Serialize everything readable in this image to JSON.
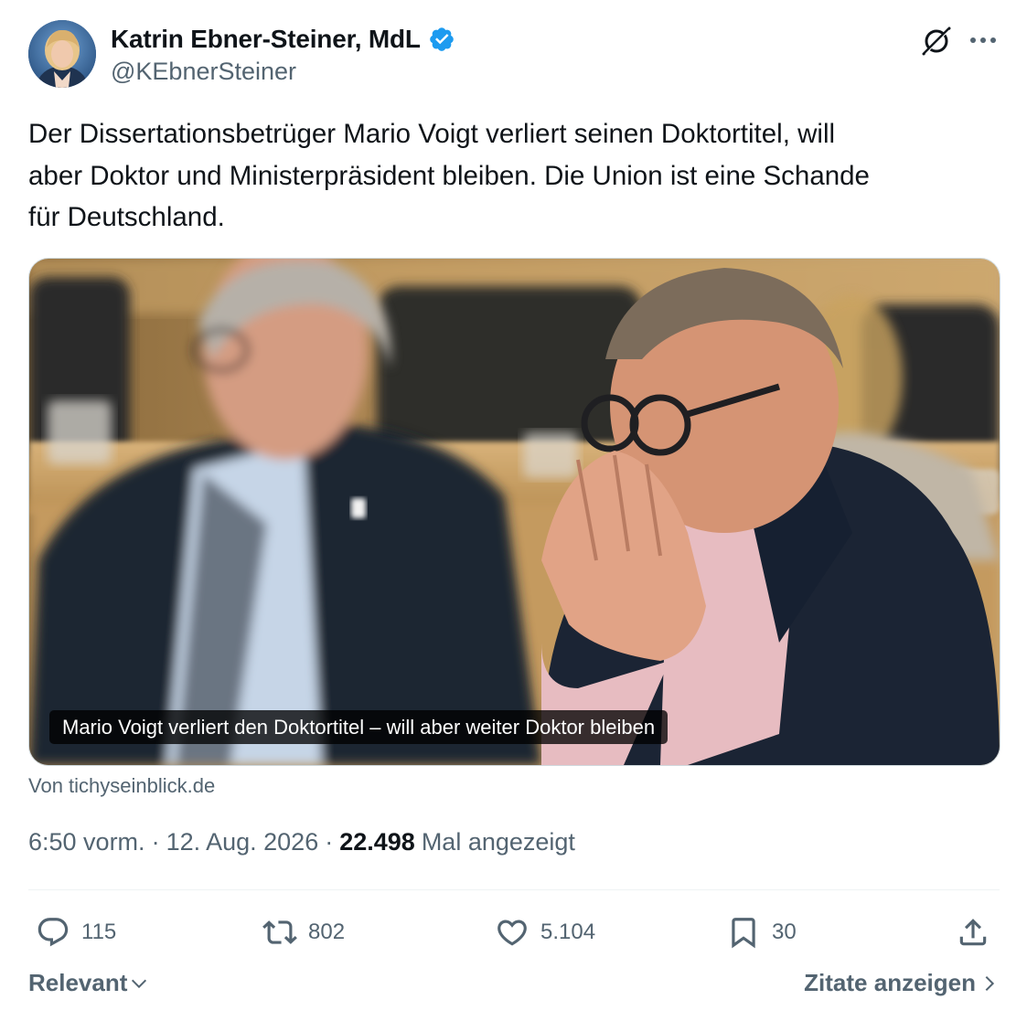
{
  "author": {
    "display_name": "Katrin Ebner-Steiner, MdL",
    "handle": "@KEbnerSteiner",
    "verified_icon": "verified-badge-icon",
    "avatar_icon": "avatar",
    "brand_color": "#1d9bf0"
  },
  "header_actions": {
    "grok_icon": "grok-icon",
    "more_icon": "more-dots-icon"
  },
  "tweet": {
    "text": "Der Dissertationsbetrüger Mario Voigt verliert seinen Doktortitel, will\naber Doktor und Ministerpräsident bleiben. Die Union ist eine Schande\nfür Deutschland."
  },
  "link_card": {
    "caption": "Mario Voigt verliert den Doktortitel – will aber weiter Doktor bleiben",
    "source": "Von tichyseinblick.de"
  },
  "meta": {
    "time": "6:50 vorm.",
    "separator": "·",
    "date": "12. Aug. 2026",
    "views_count": "22.498",
    "views_label": "Mal angezeigt"
  },
  "actions": {
    "replies": {
      "icon": "reply-icon",
      "count": "115"
    },
    "reposts": {
      "icon": "repost-icon",
      "count": "802"
    },
    "likes": {
      "icon": "heart-icon",
      "count": "5.104"
    },
    "bookmarks": {
      "icon": "bookmark-icon",
      "count": "30"
    },
    "share": {
      "icon": "share-icon"
    }
  },
  "footer": {
    "sort_label": "Relevant",
    "quotes_label": "Zitate anzeigen"
  },
  "colors": {
    "text_primary": "#0f1419",
    "text_secondary": "#536471",
    "divider": "#eff3f4"
  }
}
